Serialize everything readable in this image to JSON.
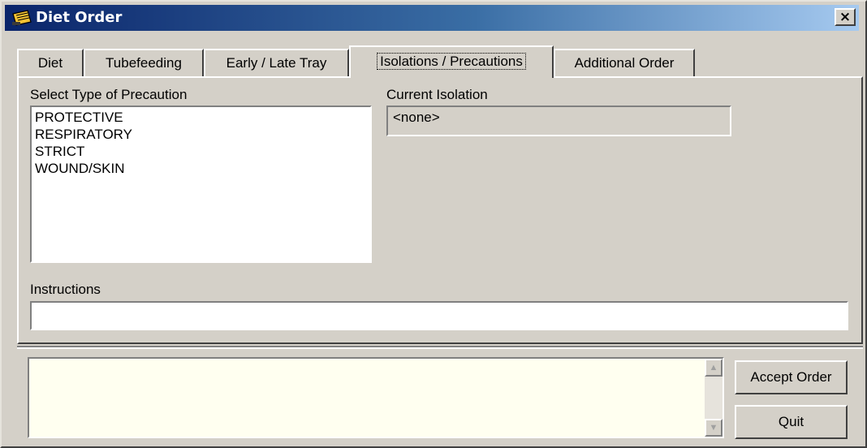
{
  "window": {
    "title": "Diet Order",
    "close_glyph": "×",
    "icon": "notepad-icon"
  },
  "tabs": [
    {
      "label": "Diet",
      "active": false
    },
    {
      "label": "Tubefeeding",
      "active": false
    },
    {
      "label": "Early / Late Tray",
      "active": false
    },
    {
      "label": "Isolations / Precautions",
      "active": true
    },
    {
      "label": "Additional Order",
      "active": false
    }
  ],
  "precaution": {
    "label": "Select Type of Precaution",
    "items": [
      "PROTECTIVE",
      "RESPIRATORY",
      "STRICT",
      "WOUND/SKIN"
    ]
  },
  "current_isolation": {
    "label": "Current Isolation",
    "value": "<none>"
  },
  "instructions": {
    "label": "Instructions",
    "value": ""
  },
  "order_summary": {
    "text": "",
    "scroll_up_glyph": "▲",
    "scroll_down_glyph": "▼"
  },
  "buttons": {
    "accept": "Accept Order",
    "quit": "Quit"
  },
  "colors": {
    "face": "#d4d0c8",
    "title_start": "#0a246a",
    "title_end": "#a6caf0",
    "memo_bg": "#fffff0"
  }
}
